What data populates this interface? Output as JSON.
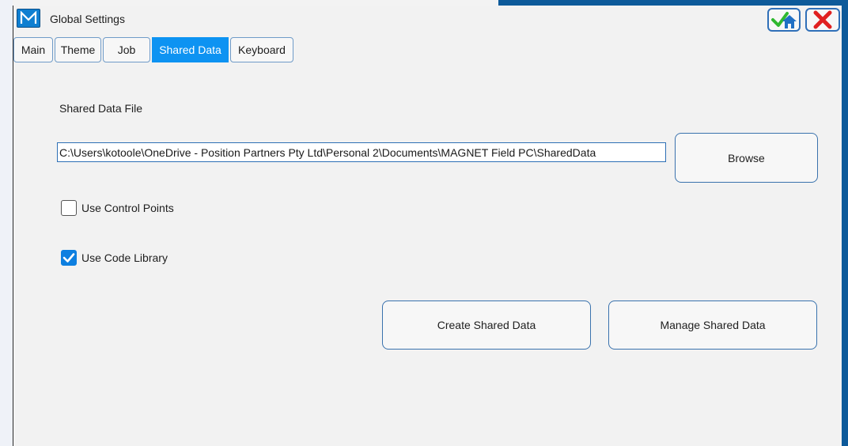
{
  "colors": {
    "accent": "#0d93f2",
    "border": "#3a72ad",
    "desktop": "#0d5a9a"
  },
  "window": {
    "title": "Global Settings",
    "logo_letter": "M",
    "ok_icon": "check-home-icon",
    "close_icon": "close-icon"
  },
  "tabs": [
    {
      "label": "Main",
      "active": false
    },
    {
      "label": "Theme",
      "active": false
    },
    {
      "label": "Job",
      "active": false
    },
    {
      "label": "Shared Data",
      "active": true
    },
    {
      "label": "Keyboard",
      "active": false
    }
  ],
  "shared_data": {
    "file_label": "Shared Data File",
    "file_path": "C:\\Users\\kotoole\\OneDrive - Position Partners Pty Ltd\\Personal 2\\Documents\\MAGNET Field PC\\SharedData",
    "browse_label": "Browse",
    "use_control_points": {
      "label": "Use Control Points",
      "checked": false
    },
    "use_code_library": {
      "label": "Use Code Library",
      "checked": true
    },
    "create_label": "Create Shared Data",
    "manage_label": "Manage Shared Data"
  }
}
